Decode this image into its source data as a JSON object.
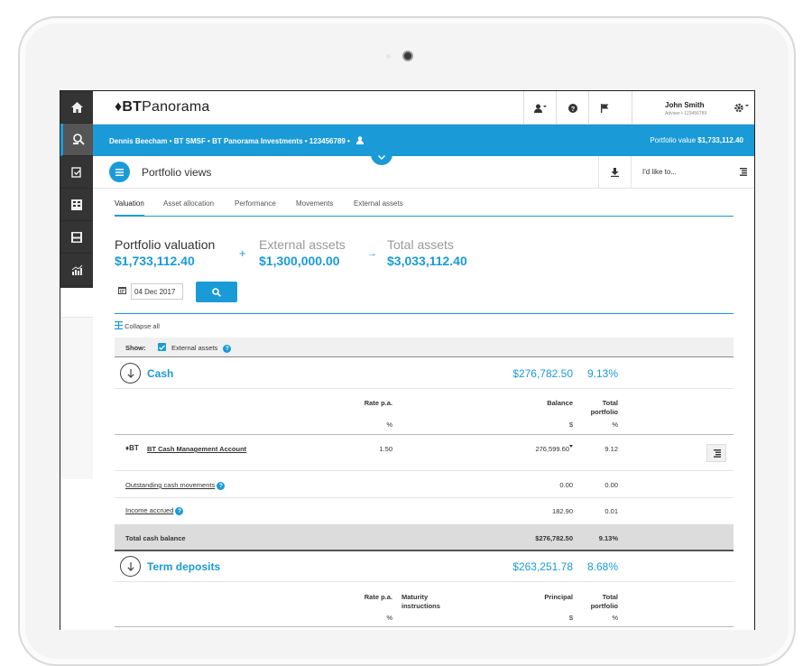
{
  "app": {
    "logo_mark": "♦BT",
    "logo_text": "Panorama"
  },
  "user": {
    "name": "John Smith",
    "role": "Adviser • 123456789"
  },
  "account_bar": {
    "account": "Dennis Beecham • BT SMSF • BT Panorama Investments • 123456789 •",
    "portfolio_label": "Portfolio value",
    "portfolio_value": "$1,733,112.40"
  },
  "page": {
    "title": "Portfolio views",
    "id_like_label": "I'd like to..."
  },
  "tabs": [
    "Valuation",
    "Asset allocation",
    "Performance",
    "Movements",
    "External assets"
  ],
  "summary": {
    "portfolio_label": "Portfolio valuation",
    "portfolio_value": "$1,733,112.40",
    "plus": "+",
    "external_label": "External assets",
    "external_value": "$1,300,000.00",
    "arrow": "→",
    "total_label": "Total assets",
    "total_value": "$3,033,112.40"
  },
  "date_filter": {
    "value": "04 Dec 2017"
  },
  "collapse_label": "Collapse all",
  "show": {
    "label": "Show:",
    "option": "External assets",
    "checked": true
  },
  "cash": {
    "title": "Cash",
    "amount": "$276,782.50",
    "pct": "9.13%",
    "headers": {
      "rate": "Rate p.a.",
      "rate_unit": "%",
      "balance": "Balance",
      "balance_unit": "$",
      "total_1": "Total",
      "total_2": "portfolio",
      "total_unit": "%"
    },
    "account_logo": "♦BT",
    "account_name": "BT Cash Management Account",
    "account_rate": "1.50",
    "account_balance": "276,599.60",
    "account_pct": "9.12",
    "outstanding_label": "Outstanding cash movements",
    "outstanding_balance": "0.00",
    "outstanding_pct": "0.00",
    "income_label": "Income accrued",
    "income_balance": "182.90",
    "income_pct": "0.01",
    "total_label": "Total cash balance",
    "total_balance": "$276,782.50",
    "total_pct": "9.13%"
  },
  "term_deposits": {
    "title": "Term deposits",
    "amount": "$263,251.78",
    "pct": "8.68%",
    "headers": {
      "rate": "Rate p.a.",
      "rate_unit": "%",
      "maturity_1": "Maturity",
      "maturity_2": "instructions",
      "principal": "Principal",
      "principal_unit": "$",
      "total_1": "Total",
      "total_2": "portfolio",
      "total_unit": "%"
    }
  },
  "icons": {
    "sidebar": [
      "home-icon",
      "portfolio-search-icon",
      "clipboard-check-icon",
      "building-icon",
      "save-icon",
      "chart-growth-icon"
    ],
    "topbar": [
      "user-menu-icon",
      "help-icon",
      "flag-icon",
      "settings-icon"
    ]
  },
  "colors": {
    "accent": "#1a9bd7",
    "sidebar": "#343434"
  }
}
